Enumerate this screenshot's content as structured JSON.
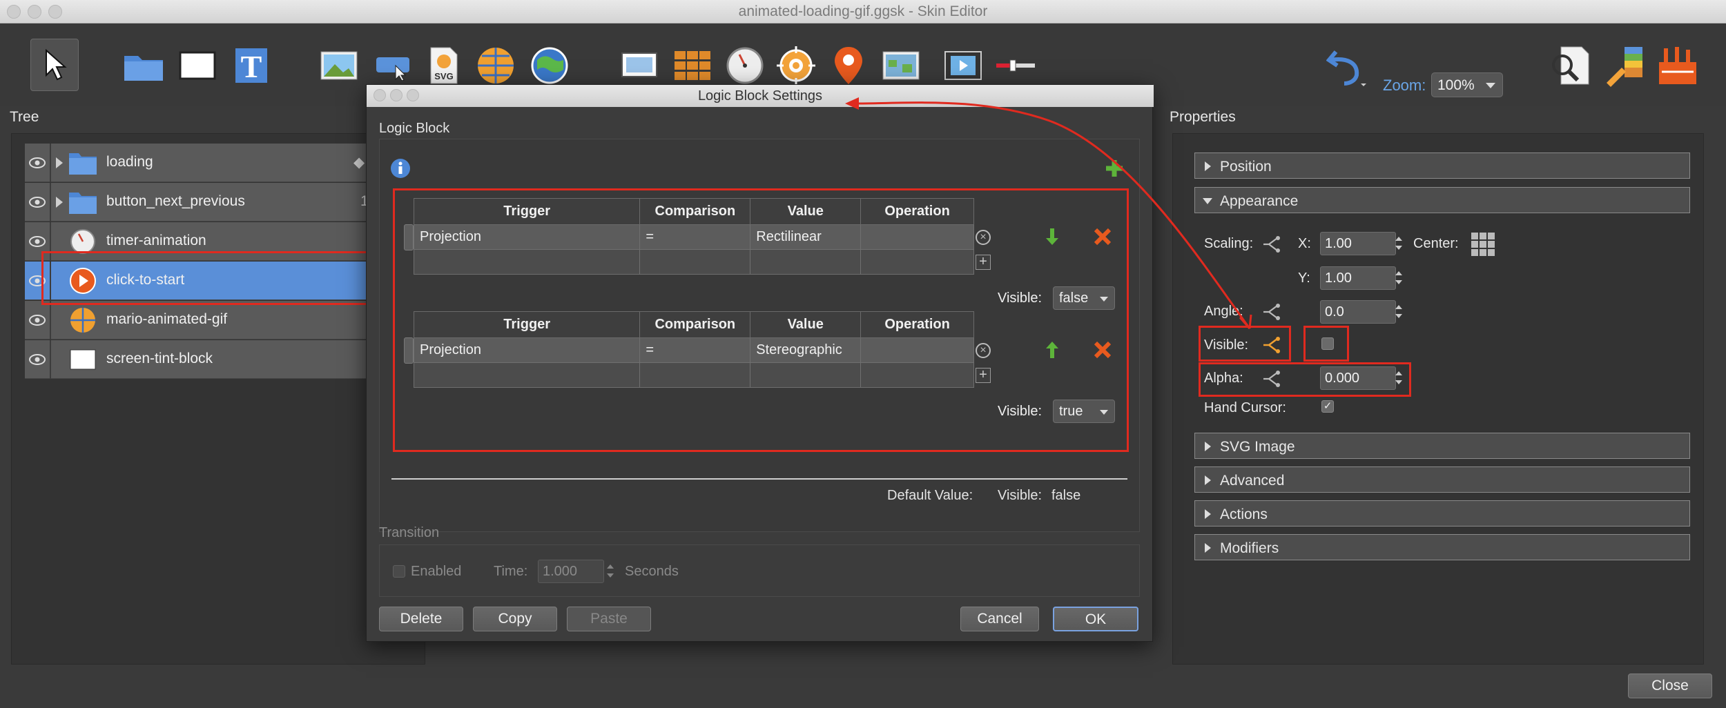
{
  "window": {
    "title": "animated-loading-gif.ggsk - Skin Editor"
  },
  "toolbar": {
    "zoom_label": "Zoom:",
    "zoom_value": "100%",
    "icons": [
      "select-arrow-icon",
      "folder-icon",
      "rectangle-icon",
      "text-icon",
      "image-icon",
      "button-icon",
      "svg-icon",
      "panorama-icon",
      "map-icon",
      "screen-icon",
      "grid-icon",
      "timer-icon",
      "hotspot-icon",
      "map-pin-icon",
      "map-image-icon",
      "video-icon",
      "slider-icon",
      "undo-icon",
      "search-icon",
      "paint-icon",
      "tools-icon"
    ]
  },
  "tree": {
    "title": "Tree",
    "rows": [
      {
        "label": "loading",
        "trail": "◆"
      },
      {
        "label": "button_next_previous",
        "trail": "1"
      },
      {
        "label": "timer-animation",
        "trail": ""
      },
      {
        "label": "click-to-start",
        "trail": ""
      },
      {
        "label": "mario-animated-gif",
        "trail": ""
      },
      {
        "label": "screen-tint-block",
        "trail": ""
      }
    ]
  },
  "properties": {
    "title": "Properties",
    "sections": {
      "position": "Position",
      "appearance": "Appearance",
      "svg_image": "SVG Image",
      "advanced": "Advanced",
      "actions": "Actions",
      "modifiers": "Modifiers"
    },
    "scaling_label": "Scaling:",
    "x_label": "X:",
    "x_value": "1.00",
    "center_label": "Center:",
    "y_label": "Y:",
    "y_value": "1.00",
    "angle_label": "Angle:",
    "angle_value": "0.0",
    "visible_label": "Visible:",
    "alpha_label": "Alpha:",
    "alpha_value": "0.000",
    "hand_cursor_label": "Hand Cursor:",
    "hand_cursor_check": "✓"
  },
  "dialog": {
    "title": "Logic Block Settings",
    "section": "Logic Block",
    "columns": [
      "Trigger",
      "Comparison",
      "Value",
      "Operation"
    ],
    "blocks": [
      {
        "trigger": "Projection",
        "comparison": "=",
        "value": "Rectilinear",
        "operation": "",
        "visible_label": "Visible:",
        "visible_value": "false"
      },
      {
        "trigger": "Projection",
        "comparison": "=",
        "value": "Stereographic",
        "operation": "",
        "visible_label": "Visible:",
        "visible_value": "true"
      }
    ],
    "default_label": "Default Value:",
    "default_vis_label": "Visible:",
    "default_vis_value": "false",
    "transition": {
      "title": "Transition",
      "enabled": "Enabled",
      "time_label": "Time:",
      "time_value": "1.000",
      "unit": "Seconds"
    },
    "buttons": {
      "delete": "Delete",
      "copy": "Copy",
      "paste": "Paste",
      "cancel": "Cancel",
      "ok": "OK"
    }
  },
  "footer": {
    "close": "Close"
  },
  "colors": {
    "accent": "#5a8fd8",
    "annotation": "#e02a1f",
    "zoom_text": "#6aa6e8"
  }
}
